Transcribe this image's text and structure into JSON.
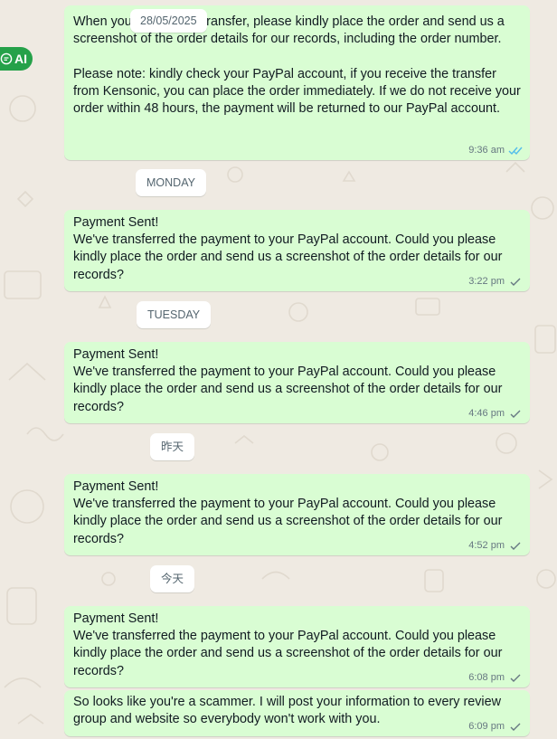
{
  "ai_badge": {
    "label": "AI",
    "icon": "ai-chat-icon"
  },
  "floating_date": "28/05/2025",
  "messages": [
    {
      "text": "When you receive the transfer, please kindly place the order and send us a screenshot of the order details for our records, including the order number.\n\nPlease note: kindly check your PayPal account, if you receive the transfer from Kensonic, you can place the order immediately. If we do not receive your order within 48 hours, the payment will be returned to our PayPal account.",
      "time": "9:36 am",
      "status": "read"
    },
    {
      "text": "Payment Sent!\nWe've transferred the payment to your PayPal account. Could you please kindly place the order and send us a screenshot of the order details for our records?",
      "time": "3:22 pm",
      "status": "sent"
    },
    {
      "text": "Payment Sent!\nWe've transferred the payment to your PayPal account. Could you please kindly place the order and send us a screenshot of the order details for our records?",
      "time": "4:46 pm",
      "status": "sent"
    },
    {
      "text": "Payment Sent!\nWe've transferred the payment to your PayPal account. Could you please kindly place the order and send us a screenshot of the order details for our records?",
      "time": "4:52 pm",
      "status": "sent"
    },
    {
      "text": "Payment Sent!\nWe've transferred the payment to your PayPal account. Could you please kindly place the order and send us a screenshot of the order details for our records?",
      "time": "6:08 pm",
      "status": "sent"
    },
    {
      "text": "So looks like you're a scammer. I will post your information to every review group and website so everybody won't work with you.",
      "time": "6:09 pm",
      "status": "sent"
    }
  ],
  "dividers": [
    "MONDAY",
    "TUESDAY",
    "昨天",
    "今天"
  ],
  "colors": {
    "background": "#efeae2",
    "outgoing_bubble": "#d9fdd3",
    "read_tick": "#53bdeb",
    "sent_tick": "#667781",
    "ai_badge": "#25a149"
  }
}
